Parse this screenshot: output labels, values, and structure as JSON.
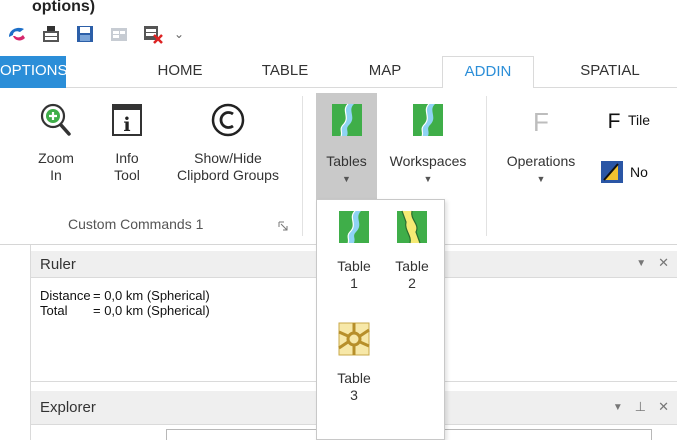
{
  "title": {
    "caption": "options)"
  },
  "qat": {
    "icons": [
      "app-logo-icon",
      "open-workspace-icon",
      "save-workspace-icon",
      "tab-icon",
      "close-table-icon"
    ],
    "overflow": "⌄"
  },
  "tabs": [
    {
      "label": "OPTIONS"
    },
    {
      "label": "HOME"
    },
    {
      "label": "TABLE"
    },
    {
      "label": "MAP"
    },
    {
      "label": "ADDIN"
    },
    {
      "label": "SPATIAL"
    }
  ],
  "ribbon": {
    "zoom_in": {
      "line1": "Zoom",
      "line2": "In"
    },
    "info_tool": {
      "line1": "Info",
      "line2": "Tool"
    },
    "show_hide": {
      "line1": "Show/Hide",
      "line2": "Clipbord Groups"
    },
    "group1_caption": "Custom Commands 1",
    "tables": "Tables",
    "workspaces": "Workspaces",
    "operations": "Operations",
    "tile_label": "Tile",
    "no_label": "No"
  },
  "ruler": {
    "title": "Ruler",
    "rows": [
      {
        "key": "Distance",
        "value": "= 0,0 km (Spherical)"
      },
      {
        "key": "Total",
        "value": "= 0,0 km (Spherical)"
      }
    ]
  },
  "explorer": {
    "title": "Explorer"
  },
  "dropdown": {
    "items": [
      {
        "line1": "Table",
        "line2": "1"
      },
      {
        "line1": "Table",
        "line2": "2"
      },
      {
        "line1": "Table",
        "line2": "3"
      }
    ]
  },
  "colors": {
    "accent": "#2b8ed8",
    "pressed": "#c9c9c9",
    "table_green": "#3fae49"
  }
}
